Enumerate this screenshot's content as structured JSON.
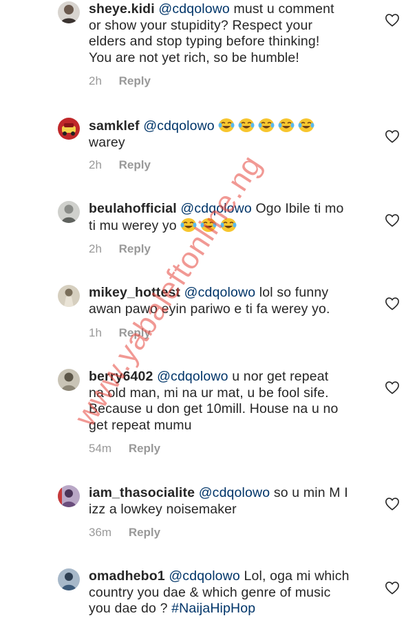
{
  "comments": [
    {
      "username": "sheye.kidi",
      "mention": "@cdqolowo",
      "text": " must u comment\nor show your stupidity? Respect your\nelders and stop typing before thinking!\nYou are not yet rich, so be humble!",
      "time": "2h",
      "reply_label": "Reply",
      "avatar_color": "#6b5a4e",
      "emoji_count": 0
    },
    {
      "username": "samklef",
      "mention": "@cdqolowo",
      "text": "",
      "text_after_emoji": "warey",
      "time": "2h",
      "reply_label": "Reply",
      "avatar_color": "#c0282a",
      "emoji_count": 5
    },
    {
      "username": "beulahofficial",
      "mention": "@cdqolowo",
      "text": " Ogo Ibile ti mo\nti mu werey yo",
      "time": "2h",
      "reply_label": "Reply",
      "avatar_color": "#9a9c98",
      "emoji_count": 3
    },
    {
      "username": "mikey_hottest",
      "mention": "@cdqolowo",
      "text": "  lol so funny\nawan pawo eyin pariwo e ti fa werey yo.",
      "time": "1h",
      "reply_label": "Reply",
      "avatar_color": "#a89c88",
      "emoji_count": 0
    },
    {
      "username": "berry6402",
      "mention": "@cdqolowo",
      "text": " u nor get repeat\nna old man, mi na ur mat, u be fool sife.\nBecause u don get 10mill. House na u no\nget repeat mumu",
      "time": "54m",
      "reply_label": "Reply",
      "avatar_color": "#8c8676",
      "emoji_count": 0
    },
    {
      "username": "iam_thasocialite",
      "mention": "@cdqolowo",
      "text": " so u min M I\nizz a lowkey noisemaker",
      "time": "36m",
      "reply_label": "Reply",
      "avatar_color": "#6a4d7c",
      "emoji_count": 0
    },
    {
      "username": "omadhebo1",
      "mention": "@cdqolowo",
      "text": " Lol, oga mi which\ncountry you dae & which genre of music\nyou dae do ? ",
      "hashtag": "#NaijaHipHop",
      "time": "",
      "reply_label": "",
      "avatar_color": "#3c5a7a",
      "emoji_count": 0
    }
  ],
  "icons": {
    "like": "heart-outline-icon",
    "emoji": "face-with-tears-of-joy-icon"
  },
  "watermark": "www.yabaleftonline.ng",
  "colors": {
    "username": "#262626",
    "mention": "#003569",
    "meta": "#999999",
    "watermark": "#e6463c"
  }
}
